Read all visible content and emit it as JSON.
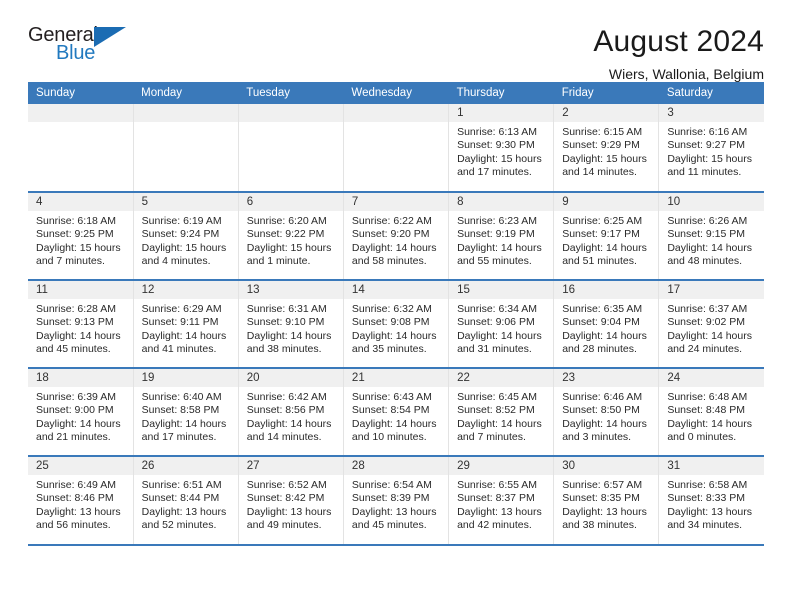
{
  "brand": {
    "word_one": "General",
    "word_two": "Blue",
    "triangle_color": "#1b6cb3",
    "blue_text_color": "#2179bf"
  },
  "header": {
    "title": "August 2024",
    "subtitle": "Wiers, Wallonia, Belgium"
  },
  "theme": {
    "header_blue": "#3a79ba",
    "daynum_bg": "#f0f0f0"
  },
  "weekday_headers": [
    "Sunday",
    "Monday",
    "Tuesday",
    "Wednesday",
    "Thursday",
    "Friday",
    "Saturday"
  ],
  "weeks": [
    [
      {
        "day": "",
        "empty": true,
        "sunrise": "",
        "sunset": "",
        "daylight_1": "",
        "daylight_2": ""
      },
      {
        "day": "",
        "empty": true,
        "sunrise": "",
        "sunset": "",
        "daylight_1": "",
        "daylight_2": ""
      },
      {
        "day": "",
        "empty": true,
        "sunrise": "",
        "sunset": "",
        "daylight_1": "",
        "daylight_2": ""
      },
      {
        "day": "",
        "empty": true,
        "sunrise": "",
        "sunset": "",
        "daylight_1": "",
        "daylight_2": ""
      },
      {
        "day": "1",
        "empty": false,
        "sunrise": "Sunrise: 6:13 AM",
        "sunset": "Sunset: 9:30 PM",
        "daylight_1": "Daylight: 15 hours",
        "daylight_2": "and 17 minutes."
      },
      {
        "day": "2",
        "empty": false,
        "sunrise": "Sunrise: 6:15 AM",
        "sunset": "Sunset: 9:29 PM",
        "daylight_1": "Daylight: 15 hours",
        "daylight_2": "and 14 minutes."
      },
      {
        "day": "3",
        "empty": false,
        "sunrise": "Sunrise: 6:16 AM",
        "sunset": "Sunset: 9:27 PM",
        "daylight_1": "Daylight: 15 hours",
        "daylight_2": "and 11 minutes."
      }
    ],
    [
      {
        "day": "4",
        "empty": false,
        "sunrise": "Sunrise: 6:18 AM",
        "sunset": "Sunset: 9:25 PM",
        "daylight_1": "Daylight: 15 hours",
        "daylight_2": "and 7 minutes."
      },
      {
        "day": "5",
        "empty": false,
        "sunrise": "Sunrise: 6:19 AM",
        "sunset": "Sunset: 9:24 PM",
        "daylight_1": "Daylight: 15 hours",
        "daylight_2": "and 4 minutes."
      },
      {
        "day": "6",
        "empty": false,
        "sunrise": "Sunrise: 6:20 AM",
        "sunset": "Sunset: 9:22 PM",
        "daylight_1": "Daylight: 15 hours",
        "daylight_2": "and 1 minute."
      },
      {
        "day": "7",
        "empty": false,
        "sunrise": "Sunrise: 6:22 AM",
        "sunset": "Sunset: 9:20 PM",
        "daylight_1": "Daylight: 14 hours",
        "daylight_2": "and 58 minutes."
      },
      {
        "day": "8",
        "empty": false,
        "sunrise": "Sunrise: 6:23 AM",
        "sunset": "Sunset: 9:19 PM",
        "daylight_1": "Daylight: 14 hours",
        "daylight_2": "and 55 minutes."
      },
      {
        "day": "9",
        "empty": false,
        "sunrise": "Sunrise: 6:25 AM",
        "sunset": "Sunset: 9:17 PM",
        "daylight_1": "Daylight: 14 hours",
        "daylight_2": "and 51 minutes."
      },
      {
        "day": "10",
        "empty": false,
        "sunrise": "Sunrise: 6:26 AM",
        "sunset": "Sunset: 9:15 PM",
        "daylight_1": "Daylight: 14 hours",
        "daylight_2": "and 48 minutes."
      }
    ],
    [
      {
        "day": "11",
        "empty": false,
        "sunrise": "Sunrise: 6:28 AM",
        "sunset": "Sunset: 9:13 PM",
        "daylight_1": "Daylight: 14 hours",
        "daylight_2": "and 45 minutes."
      },
      {
        "day": "12",
        "empty": false,
        "sunrise": "Sunrise: 6:29 AM",
        "sunset": "Sunset: 9:11 PM",
        "daylight_1": "Daylight: 14 hours",
        "daylight_2": "and 41 minutes."
      },
      {
        "day": "13",
        "empty": false,
        "sunrise": "Sunrise: 6:31 AM",
        "sunset": "Sunset: 9:10 PM",
        "daylight_1": "Daylight: 14 hours",
        "daylight_2": "and 38 minutes."
      },
      {
        "day": "14",
        "empty": false,
        "sunrise": "Sunrise: 6:32 AM",
        "sunset": "Sunset: 9:08 PM",
        "daylight_1": "Daylight: 14 hours",
        "daylight_2": "and 35 minutes."
      },
      {
        "day": "15",
        "empty": false,
        "sunrise": "Sunrise: 6:34 AM",
        "sunset": "Sunset: 9:06 PM",
        "daylight_1": "Daylight: 14 hours",
        "daylight_2": "and 31 minutes."
      },
      {
        "day": "16",
        "empty": false,
        "sunrise": "Sunrise: 6:35 AM",
        "sunset": "Sunset: 9:04 PM",
        "daylight_1": "Daylight: 14 hours",
        "daylight_2": "and 28 minutes."
      },
      {
        "day": "17",
        "empty": false,
        "sunrise": "Sunrise: 6:37 AM",
        "sunset": "Sunset: 9:02 PM",
        "daylight_1": "Daylight: 14 hours",
        "daylight_2": "and 24 minutes."
      }
    ],
    [
      {
        "day": "18",
        "empty": false,
        "sunrise": "Sunrise: 6:39 AM",
        "sunset": "Sunset: 9:00 PM",
        "daylight_1": "Daylight: 14 hours",
        "daylight_2": "and 21 minutes."
      },
      {
        "day": "19",
        "empty": false,
        "sunrise": "Sunrise: 6:40 AM",
        "sunset": "Sunset: 8:58 PM",
        "daylight_1": "Daylight: 14 hours",
        "daylight_2": "and 17 minutes."
      },
      {
        "day": "20",
        "empty": false,
        "sunrise": "Sunrise: 6:42 AM",
        "sunset": "Sunset: 8:56 PM",
        "daylight_1": "Daylight: 14 hours",
        "daylight_2": "and 14 minutes."
      },
      {
        "day": "21",
        "empty": false,
        "sunrise": "Sunrise: 6:43 AM",
        "sunset": "Sunset: 8:54 PM",
        "daylight_1": "Daylight: 14 hours",
        "daylight_2": "and 10 minutes."
      },
      {
        "day": "22",
        "empty": false,
        "sunrise": "Sunrise: 6:45 AM",
        "sunset": "Sunset: 8:52 PM",
        "daylight_1": "Daylight: 14 hours",
        "daylight_2": "and 7 minutes."
      },
      {
        "day": "23",
        "empty": false,
        "sunrise": "Sunrise: 6:46 AM",
        "sunset": "Sunset: 8:50 PM",
        "daylight_1": "Daylight: 14 hours",
        "daylight_2": "and 3 minutes."
      },
      {
        "day": "24",
        "empty": false,
        "sunrise": "Sunrise: 6:48 AM",
        "sunset": "Sunset: 8:48 PM",
        "daylight_1": "Daylight: 14 hours",
        "daylight_2": "and 0 minutes."
      }
    ],
    [
      {
        "day": "25",
        "empty": false,
        "sunrise": "Sunrise: 6:49 AM",
        "sunset": "Sunset: 8:46 PM",
        "daylight_1": "Daylight: 13 hours",
        "daylight_2": "and 56 minutes."
      },
      {
        "day": "26",
        "empty": false,
        "sunrise": "Sunrise: 6:51 AM",
        "sunset": "Sunset: 8:44 PM",
        "daylight_1": "Daylight: 13 hours",
        "daylight_2": "and 52 minutes."
      },
      {
        "day": "27",
        "empty": false,
        "sunrise": "Sunrise: 6:52 AM",
        "sunset": "Sunset: 8:42 PM",
        "daylight_1": "Daylight: 13 hours",
        "daylight_2": "and 49 minutes."
      },
      {
        "day": "28",
        "empty": false,
        "sunrise": "Sunrise: 6:54 AM",
        "sunset": "Sunset: 8:39 PM",
        "daylight_1": "Daylight: 13 hours",
        "daylight_2": "and 45 minutes."
      },
      {
        "day": "29",
        "empty": false,
        "sunrise": "Sunrise: 6:55 AM",
        "sunset": "Sunset: 8:37 PM",
        "daylight_1": "Daylight: 13 hours",
        "daylight_2": "and 42 minutes."
      },
      {
        "day": "30",
        "empty": false,
        "sunrise": "Sunrise: 6:57 AM",
        "sunset": "Sunset: 8:35 PM",
        "daylight_1": "Daylight: 13 hours",
        "daylight_2": "and 38 minutes."
      },
      {
        "day": "31",
        "empty": false,
        "sunrise": "Sunrise: 6:58 AM",
        "sunset": "Sunset: 8:33 PM",
        "daylight_1": "Daylight: 13 hours",
        "daylight_2": "and 34 minutes."
      }
    ]
  ]
}
